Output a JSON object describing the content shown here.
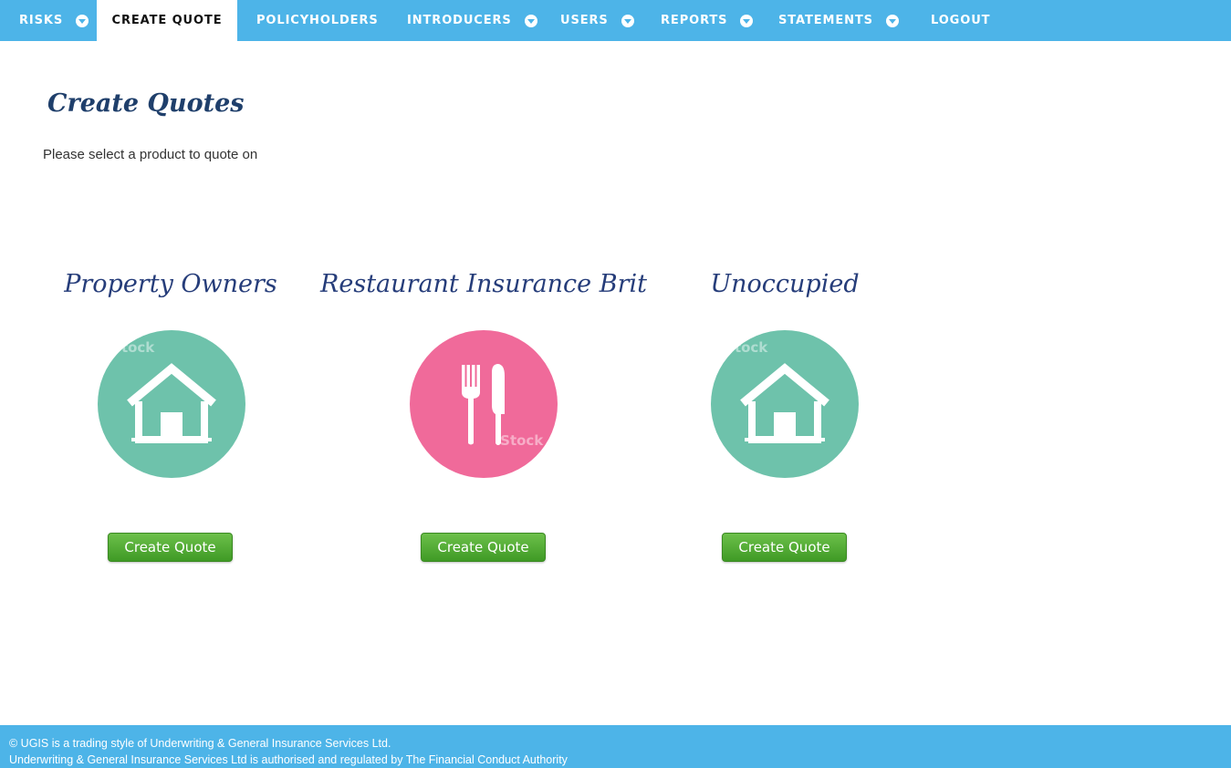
{
  "nav": {
    "items": [
      {
        "label": "RISKS",
        "dropdown": true
      },
      {
        "label": "CREATE QUOTE",
        "dropdown": false,
        "active": true
      },
      {
        "label": "POLICYHOLDERS",
        "dropdown": false
      },
      {
        "label": "INTRODUCERS",
        "dropdown": true
      },
      {
        "label": "USERS",
        "dropdown": true
      },
      {
        "label": "REPORTS",
        "dropdown": true
      },
      {
        "label": "STATEMENTS",
        "dropdown": true
      },
      {
        "label": "LOGOUT",
        "dropdown": false
      }
    ]
  },
  "page": {
    "title": "Create Quotes",
    "subtitle": "Please select a product to quote on"
  },
  "products": [
    {
      "title": "Property Owners",
      "icon": "house-icon",
      "button_label": "Create Quote",
      "color": "#6ec2ab"
    },
    {
      "title": "Restaurant Insurance Brit",
      "icon": "fork-knife-icon",
      "button_label": "Create Quote",
      "color": "#f06a9a"
    },
    {
      "title": "Unoccupied",
      "icon": "house-icon",
      "button_label": "Create Quote",
      "color": "#6ec2ab"
    }
  ],
  "watermark": "iStock",
  "footer": {
    "line1": "© UGIS is a trading style of Underwriting & General Insurance Services Ltd.",
    "line2": "Underwriting & General Insurance Services Ltd is authorised and regulated by The Financial Conduct Authority"
  },
  "colors": {
    "nav_bg": "#4db4e8",
    "title_text": "#1f3f6b",
    "button_green": "#4fa82f"
  }
}
